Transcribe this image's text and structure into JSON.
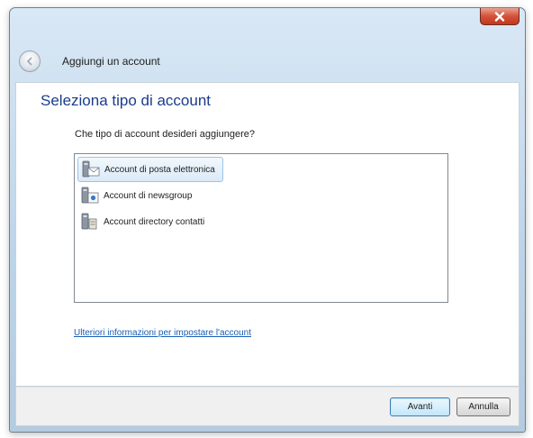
{
  "window": {
    "header_title": "Aggiungi un account"
  },
  "main": {
    "title": "Seleziona tipo di account",
    "question": "Che tipo di account desideri aggiungere?",
    "account_types": [
      {
        "label": "Account di posta elettronica",
        "icon": "mail-account-icon",
        "selected": true
      },
      {
        "label": "Account di newsgroup",
        "icon": "newsgroup-account-icon",
        "selected": false
      },
      {
        "label": "Account directory contatti",
        "icon": "directory-account-icon",
        "selected": false
      }
    ],
    "help_link": "Ulteriori informazioni per impostare l'account"
  },
  "footer": {
    "next_label": "Avanti",
    "cancel_label": "Annulla"
  },
  "colors": {
    "title_blue": "#1a3c8c",
    "link_blue": "#1a5fb4",
    "selection_border": "#9cc3e6",
    "close_red": "#c2371f"
  }
}
